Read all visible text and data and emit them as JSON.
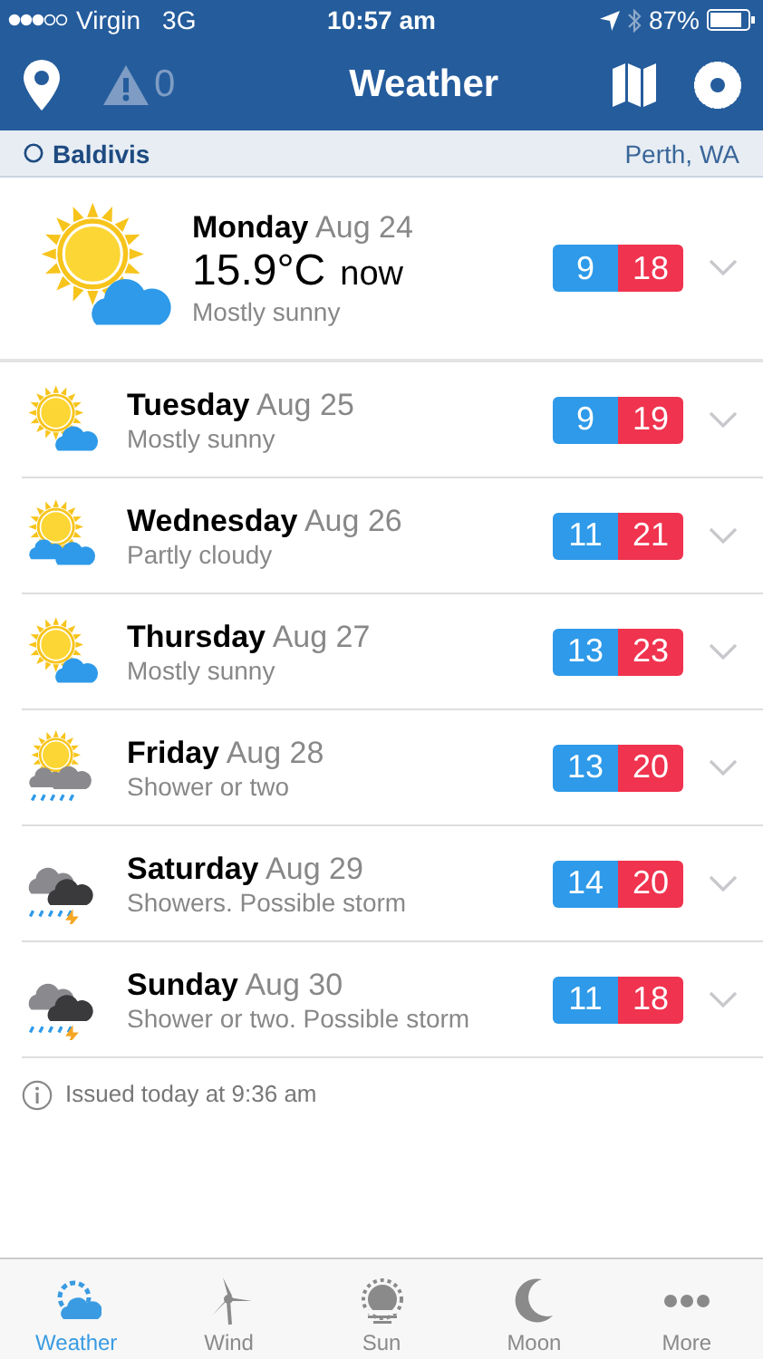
{
  "status_bar": {
    "carrier": "Virgin",
    "network": "3G",
    "time": "10:57 am",
    "battery": "87%"
  },
  "nav": {
    "title": "Weather",
    "alert_count": "0"
  },
  "location": {
    "name": "Baldivis",
    "region": "Perth, WA"
  },
  "today": {
    "day": "Monday",
    "date": "Aug 24",
    "temperature": "15.9°C",
    "now": "now",
    "summary": "Mostly sunny",
    "kind": "sun-cloud",
    "min": "9",
    "max": "18",
    "expanded": false
  },
  "days": [
    {
      "day": "Tuesday",
      "date": "Aug 25",
      "summary": "Mostly sunny",
      "kind": "sun-cloud",
      "min": "9",
      "max": "19",
      "expanded": false
    },
    {
      "day": "Wednesday",
      "date": "Aug 26",
      "summary": "Partly cloudy",
      "kind": "partly-cloudy",
      "min": "11",
      "max": "21",
      "expanded": false
    },
    {
      "day": "Thursday",
      "date": "Aug 27",
      "summary": "Mostly sunny",
      "kind": "sun-cloud",
      "min": "13",
      "max": "23",
      "expanded": false
    },
    {
      "day": "Friday",
      "date": "Aug 28",
      "summary": "Shower or two",
      "kind": "shower",
      "min": "13",
      "max": "20",
      "expanded": false
    },
    {
      "day": "Saturday",
      "date": "Aug 29",
      "summary": "Showers. Possible storm",
      "kind": "storm",
      "min": "14",
      "max": "20",
      "expanded": false
    },
    {
      "day": "Sunday",
      "date": "Aug 30",
      "summary": "Shower or two. Possible storm",
      "kind": "storm",
      "min": "11",
      "max": "18",
      "expanded": false
    }
  ],
  "issued": "Issued today at 9:36 am",
  "tabs": [
    {
      "label": "Weather",
      "kind": "weather",
      "selected": true
    },
    {
      "label": "Wind",
      "kind": "wind",
      "selected": false
    },
    {
      "label": "Sun",
      "kind": "sun",
      "selected": false
    },
    {
      "label": "Moon",
      "kind": "moon",
      "selected": false
    },
    {
      "label": "More",
      "kind": "more",
      "selected": false
    }
  ]
}
